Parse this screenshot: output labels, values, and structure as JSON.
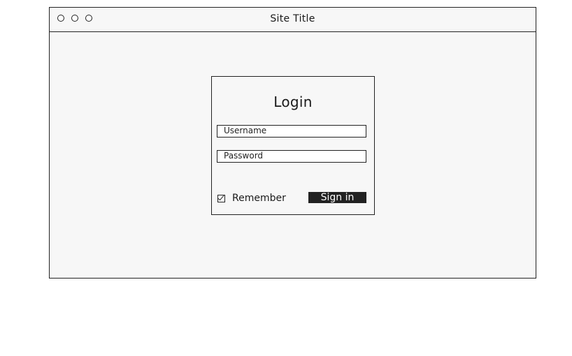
{
  "window": {
    "title": "Site Title"
  },
  "login": {
    "heading": "Login",
    "username_placeholder": "Username",
    "password_placeholder": "Password",
    "remember_label": "Remember",
    "remember_checked": true,
    "signin_label": "Sign in"
  },
  "icons": {
    "window_controls": [
      "window-dot-icon",
      "window-dot-icon",
      "window-dot-icon"
    ],
    "remember": "checkbox-checked-icon"
  },
  "colors": {
    "stroke": "#222222",
    "window_bg": "#f7f7f7",
    "button_bg": "#222222",
    "button_text": "#ffffff"
  }
}
